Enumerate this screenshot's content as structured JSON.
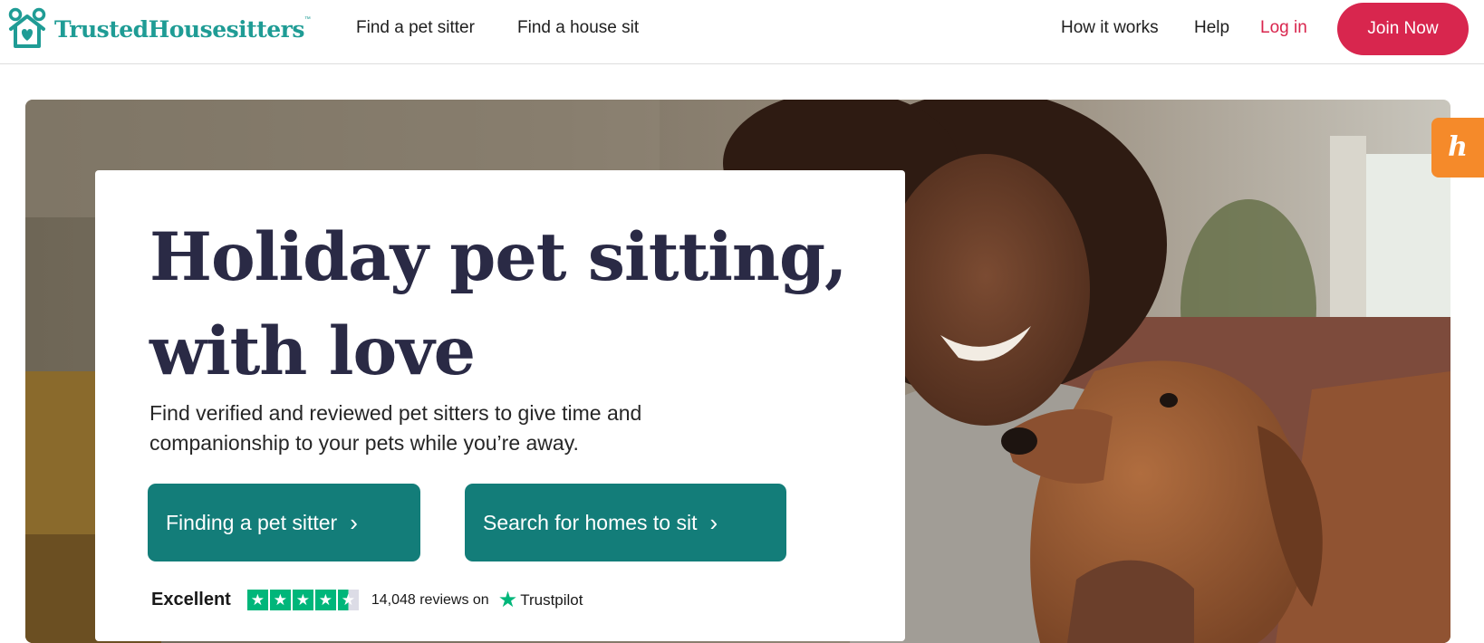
{
  "header": {
    "logo_text": "TrustedHousesitters",
    "logo_tm": "™",
    "nav_left": [
      "Find a pet sitter",
      "Find a house sit"
    ],
    "nav_right": {
      "how": "How it works",
      "help": "Help",
      "login": "Log in"
    },
    "join_label": "Join Now"
  },
  "hero": {
    "title": "Holiday pet sitting, with love",
    "subtitle": "Find verified and reviewed pet sitters to give time and companionship to your pets while you’re away.",
    "cta_primary": "Finding a pet sitter",
    "cta_secondary": "Search for homes to sit",
    "chevron": "›",
    "rating": {
      "label": "Excellent",
      "stars": 4.5,
      "count_text": "14,048 reviews on",
      "brand": "Trustpilot"
    }
  },
  "side_widget": {
    "glyph": "h"
  },
  "colors": {
    "brand_teal": "#1f9c95",
    "cta_teal": "#137d79",
    "join_red": "#d8264e",
    "trustpilot_green": "#00b67a",
    "widget_orange": "#f58a2a"
  },
  "icons": [
    "house-logo-icon",
    "chevron-right-icon",
    "star-icon",
    "trustpilot-star-icon"
  ]
}
